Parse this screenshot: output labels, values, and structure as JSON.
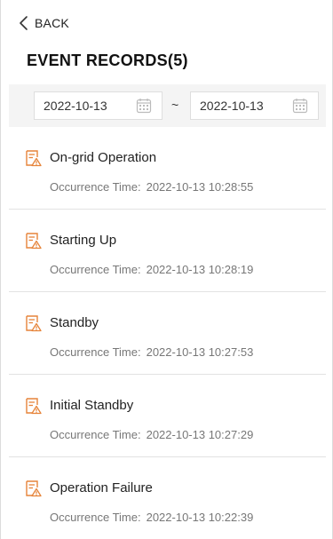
{
  "header": {
    "back_label": "BACK",
    "title": "EVENT RECORDS(5)"
  },
  "filter": {
    "start_date": "2022-10-13",
    "separator": "~",
    "end_date": "2022-10-13"
  },
  "colors": {
    "accent": "#e6843a"
  },
  "events": [
    {
      "name": "On-grid Operation",
      "occurrence_label": "Occurrence Time:",
      "time": "2022-10-13 10:28:55"
    },
    {
      "name": "Starting Up",
      "occurrence_label": "Occurrence Time:",
      "time": "2022-10-13 10:28:19"
    },
    {
      "name": "Standby",
      "occurrence_label": "Occurrence Time:",
      "time": "2022-10-13 10:27:53"
    },
    {
      "name": "Initial Standby",
      "occurrence_label": "Occurrence Time:",
      "time": "2022-10-13 10:27:29"
    },
    {
      "name": "Operation Failure",
      "occurrence_label": "Occurrence Time:",
      "time": "2022-10-13 10:22:39"
    }
  ]
}
